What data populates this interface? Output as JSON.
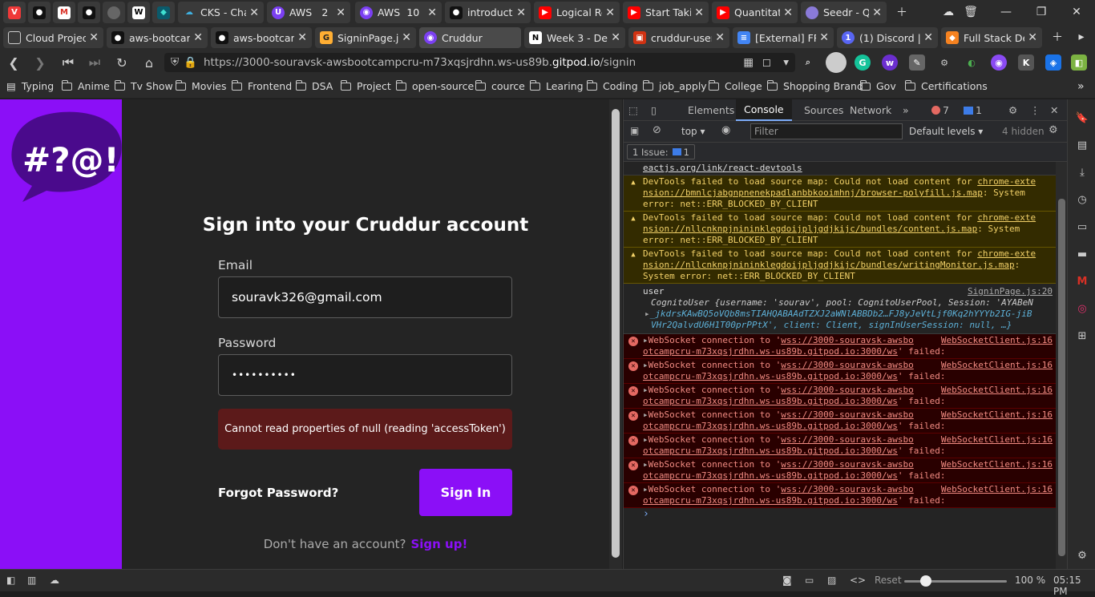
{
  "browser": {
    "tab_row1": [
      {
        "label": "",
        "icon": "vivaldi-icon"
      },
      {
        "label": "",
        "icon": "github-icon"
      },
      {
        "label": "",
        "icon": "gmail-icon"
      },
      {
        "label": "",
        "icon": "github-icon"
      },
      {
        "label": "",
        "icon": "globe-icon"
      },
      {
        "label": "",
        "icon": "webflow-icon"
      },
      {
        "label": "",
        "icon": "webstorm-icon"
      },
      {
        "label": "CKS - Cha",
        "icon": "cks-icon"
      },
      {
        "label": "AWS",
        "count": "2",
        "icon": "aws-icon"
      },
      {
        "label": "AWS",
        "count": "10",
        "icon": "aws-icon"
      },
      {
        "label": "introducti",
        "icon": "github-icon"
      },
      {
        "label": "Logical Re",
        "icon": "youtube-icon"
      },
      {
        "label": "Start Takir",
        "icon": "youtube-icon"
      },
      {
        "label": "Quantitati",
        "icon": "youtube-icon"
      },
      {
        "label": "Seedr - Q",
        "icon": "seedr-icon"
      }
    ],
    "tab_row2": [
      {
        "label": "Cloud Project",
        "icon": "doc-icon"
      },
      {
        "label": "aws-bootcam",
        "icon": "github-icon"
      },
      {
        "label": "aws-bootcam",
        "icon": "github-icon"
      },
      {
        "label": "SigninPage.js",
        "icon": "gitpod-icon"
      },
      {
        "label": "Cruddur",
        "icon": "cruddur-icon"
      },
      {
        "label": "Week 3 - Dec",
        "icon": "notion-icon"
      },
      {
        "label": "cruddur-user",
        "icon": "aws-icon"
      },
      {
        "label": "[External] FRE",
        "icon": "docs-icon"
      },
      {
        "label": "(1) Discord | #",
        "icon": "discord-icon"
      },
      {
        "label": "Full Stack Dev",
        "icon": "box-icon"
      }
    ],
    "address": {
      "prefix": "https://3000-souravsk-awsbootcampcru-m73xqsjrdhn.ws-us89b.",
      "domain": "gitpod.io",
      "path": "/signin"
    },
    "bookmarks": [
      "Typing",
      "Anime",
      "Tv Show",
      "Movies",
      "Frontend",
      "DSA",
      "Project",
      "open-source",
      "cource",
      "Learing",
      "Coding",
      "job_apply",
      "College",
      "Shopping Brand",
      "Gov",
      "Certifications"
    ]
  },
  "page": {
    "logo_text": "#?@!",
    "title": "Sign into your Cruddur account",
    "email_label": "Email",
    "email_value": "souravk326@gmail.com",
    "password_label": "Password",
    "password_value": "••••••••••",
    "error": "Cannot read properties of null (reading 'accessToken')",
    "forgot": "Forgot Password?",
    "sign_in": "Sign In",
    "no_account": "Don't have an account?",
    "sign_up": "Sign up!"
  },
  "devtools": {
    "tabs": [
      "Elements",
      "Console",
      "Sources",
      "Network"
    ],
    "active_tab": "Console",
    "error_count": "7",
    "message_count": "1",
    "context": "top",
    "filter_placeholder": "Filter",
    "levels": "Default levels",
    "hidden": "4 hidden",
    "issues_label": "1 Issue:",
    "issues_count": "1",
    "top_line": "eactjs.org/link/react-devtools",
    "warnings": [
      {
        "l1": "DevTools failed to load source map: Could not load content for ",
        "link1": "chrome-exte",
        "link2": "nsion://bmnlcjabgnpnenekpadlanbbkooimhnj/browser-polyfill.js.map",
        "l2": ": System",
        "l3": "error: net::ERR_BLOCKED_BY_CLIENT"
      },
      {
        "l1": "DevTools failed to load source map: Could not load content for ",
        "link1": "chrome-exte",
        "link2": "nsion://nllcnknpjnininklegdoijpljgdjkijc/bundles/content.js.map",
        "l2": ": System",
        "l3": "error: net::ERR_BLOCKED_BY_CLIENT"
      },
      {
        "l1": "DevTools failed to load source map: Could not load content for ",
        "link1": "chrome-exte",
        "link2": "nsion://nllcnknpjnininklegdoijpljgdjkijc/bundles/writingMonitor.js.map",
        "l2": ":",
        "l3": "System error: net::ERR_BLOCKED_BY_CLIENT"
      }
    ],
    "log": {
      "label": "user",
      "source": "SigninPage.js:20",
      "obj1": "CognitoUser {username: 'sourav', pool: CognitoUserPool, Session: 'AYABeN",
      "obj2": "_jkdrsKAwBQ5oVQb8msTIAHQABAAdTZXJ2aWNlABBDb2…FJ8yJeVtLjf0Kq2hYYYb2IG-jiB",
      "obj3": "VHr2QalvdU6H1T00prPPtX', client: Client, signInUserSession: null, …}"
    },
    "errors": [
      {
        "pre": "WebSocket connection to '",
        "url1": "wss://3000-souravsk-awsbo",
        "src": "WebSocketClient.js:16",
        "url2": "otcampcru-m73xqsjrdhn.ws-us89b.gitpod.io:3000/ws",
        "post": "' failed:"
      },
      {
        "pre": "WebSocket connection to '",
        "url1": "wss://3000-souravsk-awsbo",
        "src": "WebSocketClient.js:16",
        "url2": "otcampcru-m73xqsjrdhn.ws-us89b.gitpod.io:3000/ws",
        "post": "' failed:"
      },
      {
        "pre": "WebSocket connection to '",
        "url1": "wss://3000-souravsk-awsbo",
        "src": "WebSocketClient.js:16",
        "url2": "otcampcru-m73xqsjrdhn.ws-us89b.gitpod.io:3000/ws",
        "post": "' failed:"
      },
      {
        "pre": "WebSocket connection to '",
        "url1": "wss://3000-souravsk-awsbo",
        "src": "WebSocketClient.js:16",
        "url2": "otcampcru-m73xqsjrdhn.ws-us89b.gitpod.io:3000/ws",
        "post": "' failed:"
      },
      {
        "pre": "WebSocket connection to '",
        "url1": "wss://3000-souravsk-awsbo",
        "src": "WebSocketClient.js:16",
        "url2": "otcampcru-m73xqsjrdhn.ws-us89b.gitpod.io:3000/ws",
        "post": "' failed:"
      },
      {
        "pre": "WebSocket connection to '",
        "url1": "wss://3000-souravsk-awsbo",
        "src": "WebSocketClient.js:16",
        "url2": "otcampcru-m73xqsjrdhn.ws-us89b.gitpod.io:3000/ws",
        "post": "' failed:"
      },
      {
        "pre": "WebSocket connection to '",
        "url1": "wss://3000-souravsk-awsbo",
        "src": "WebSocketClient.js:16",
        "url2": "otcampcru-m73xqsjrdhn.ws-us89b.gitpod.io:3000/ws",
        "post": "' failed:"
      }
    ],
    "prompt": "›"
  },
  "statusbar": {
    "reset": "Reset",
    "zoom": "100 %",
    "time": "05:15 PM"
  },
  "colors": {
    "brand_purple": "#8b0ff7",
    "error_bg": "#5c1a1a"
  }
}
